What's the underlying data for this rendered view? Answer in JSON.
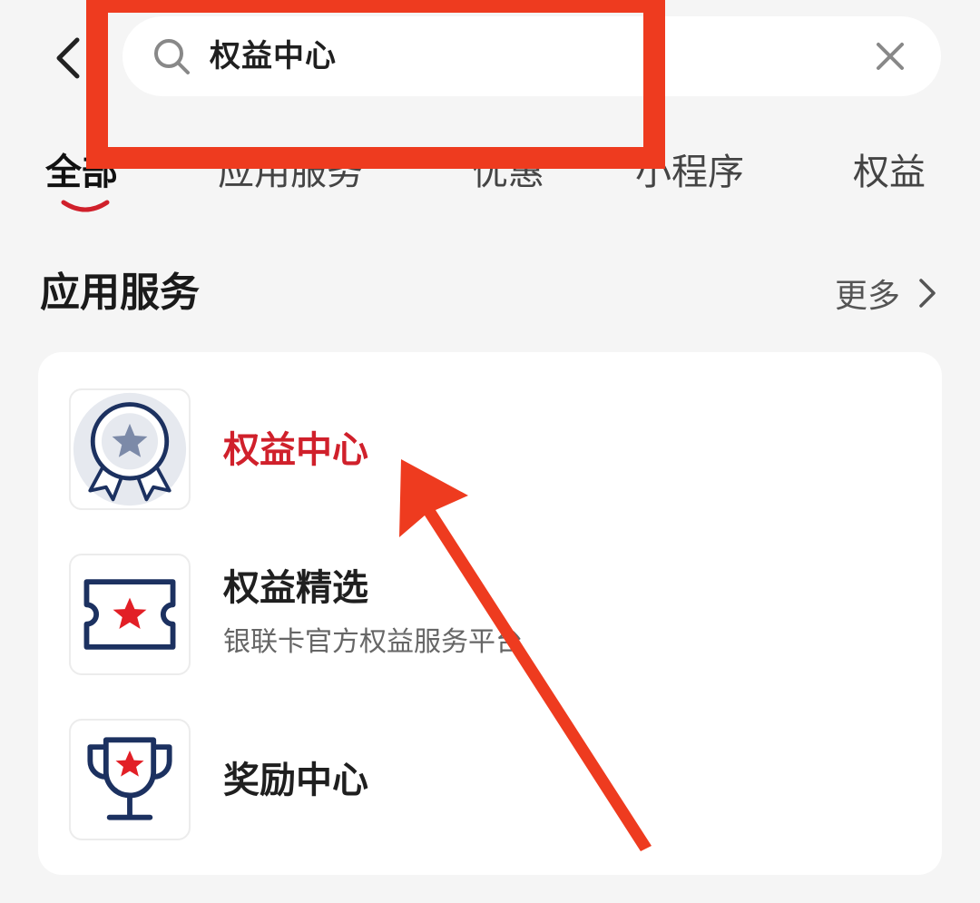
{
  "search": {
    "query": "权益中心"
  },
  "tabs": [
    {
      "label": "全部",
      "active": true
    },
    {
      "label": "应用服务",
      "active": false
    },
    {
      "label": "优惠",
      "active": false
    },
    {
      "label": "小程序",
      "active": false
    },
    {
      "label": "权益",
      "active": false
    }
  ],
  "section": {
    "title": "应用服务",
    "more_label": "更多"
  },
  "services": [
    {
      "name": "权益中心",
      "description": "",
      "icon": "medal-icon",
      "highlighted": true
    },
    {
      "name": "权益精选",
      "description": "银联卡官方权益服务平台",
      "icon": "ticket-star-icon",
      "highlighted": false
    },
    {
      "name": "奖励中心",
      "description": "",
      "icon": "trophy-icon",
      "highlighted": false
    }
  ],
  "colors": {
    "accent_red": "#d0202b",
    "annotation_red": "#ee3b1f",
    "icon_navy": "#1c3160",
    "background": "#f5f5f5"
  }
}
